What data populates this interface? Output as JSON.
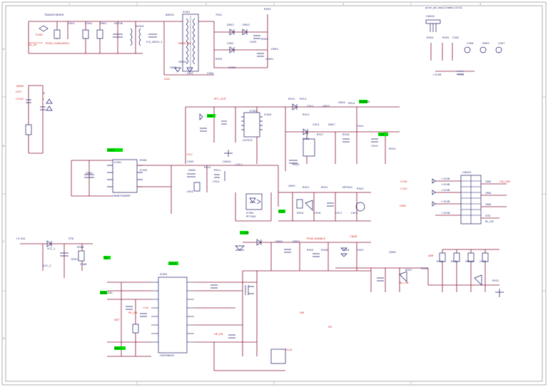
{
  "header": {
    "top_right_note": "price_pin_wod_Enable_03  AC"
  },
  "flags": {
    "green": [
      "CNO3",
      "SND(BS)",
      "+VR",
      "STB",
      "+12VB",
      "CNO3",
      "DA",
      "SND(LED)",
      "PWO",
      "SND"
    ],
    "red": [
      "MAIN",
      "POW_LOAD(EMI1)",
      "+VC",
      "FLUX",
      "CN08",
      "VR_EN",
      "POW_ENABLE"
    ]
  },
  "labels": {
    "blue": [
      "TRANSFORMER",
      "FS01",
      "C901",
      "D901",
      "NC70K",
      "SG901",
      "ICS_185CL-1",
      "BD901",
      "IC901",
      "T901",
      "D902",
      "D903",
      "C902",
      "C903",
      "R901",
      "R902",
      "ZD901",
      "L901",
      "C904",
      "Q901",
      "IC902",
      "R903",
      "D904",
      "LD901",
      "R904",
      "R905",
      "C905",
      "C906",
      "D905",
      "C907",
      "+12VB",
      "+5VS",
      "+3.3VS",
      "STB",
      "VCC_1",
      "VCC_2",
      "R906",
      "R907",
      "C908",
      "Q902",
      "IC903",
      "R908",
      "C909",
      "D906",
      "R910",
      "R911",
      "C910",
      "L902",
      "C911",
      "CN901",
      "IC904",
      "R912",
      "R913",
      "C912",
      "Q903",
      "Q904",
      "R914",
      "R915",
      "C913",
      "D907",
      "R916",
      "R917",
      "R918",
      "C914",
      "C915",
      "R919",
      "R920",
      "Q905",
      "R921",
      "R922",
      "NTC901",
      "R923",
      "R924",
      "C916",
      "C917",
      "L903",
      "D908",
      "D909",
      "R925",
      "R926",
      "C918",
      "C919",
      "Q906",
      "R927",
      "R928",
      "R929",
      "R930",
      "ZD902",
      "C920",
      "R931"
    ],
    "red": [
      "FUSE",
      "AC_IN",
      "HOT",
      "COLD",
      "N",
      "L",
      "MAIN_PW",
      "AUX",
      "PFC_OUT",
      "VCC",
      "+24V",
      "+12V",
      "GND",
      "CN_LED",
      "DIM",
      "BL_ON",
      "PS_ON",
      "DET",
      "SW",
      "FB"
    ]
  },
  "cn_top": {
    "name": "CN902",
    "pins": [
      "GND",
      "VBL",
      "VEN"
    ]
  },
  "connector": {
    "name": "CN903",
    "pins_left": [
      "+12VB",
      "+12VB",
      "+12VB",
      "+12VB",
      "+12VB"
    ],
    "pins_right": [
      "GND",
      "GND",
      "GND",
      "STB",
      "BL_ON"
    ]
  },
  "ics": [
    {
      "name": "IC901",
      "part": "FAN6755WMY"
    },
    {
      "name": "IC902",
      "part": "LD7537"
    },
    {
      "name": "IC903",
      "part": "OZ9938GN"
    },
    {
      "name": "IC904",
      "part": "PF7904"
    }
  ]
}
